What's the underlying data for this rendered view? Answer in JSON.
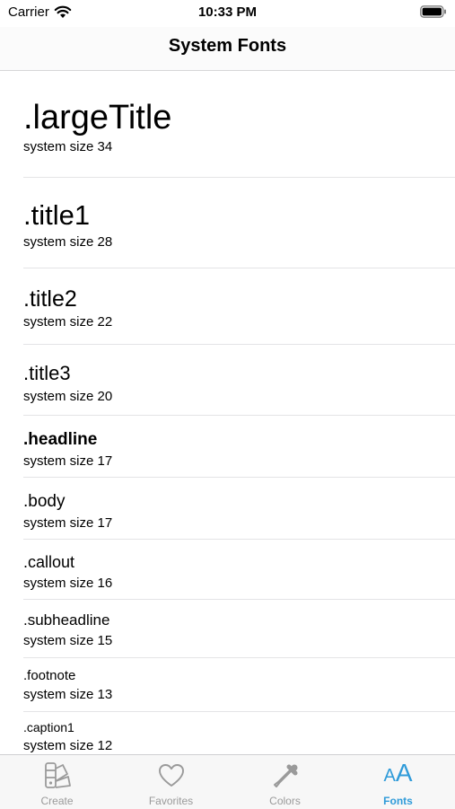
{
  "status_bar": {
    "carrier": "Carrier",
    "time": "10:33 PM"
  },
  "nav": {
    "title": "System Fonts"
  },
  "fonts": [
    {
      "name": ".largeTitle",
      "desc": "system size 34"
    },
    {
      "name": ".title1",
      "desc": "system size 28"
    },
    {
      "name": ".title2",
      "desc": "system size 22"
    },
    {
      "name": ".title3",
      "desc": "system size 20"
    },
    {
      "name": ".headline",
      "desc": "system size 17"
    },
    {
      "name": ".body",
      "desc": "system size 17"
    },
    {
      "name": ".callout",
      "desc": "system size 16"
    },
    {
      "name": ".subheadline",
      "desc": "system size 15"
    },
    {
      "name": ".footnote",
      "desc": "system size 13"
    },
    {
      "name": ".caption1",
      "desc": "system size 12"
    }
  ],
  "tabs": [
    {
      "label": "Create",
      "icon": "swatchbook-icon"
    },
    {
      "label": "Favorites",
      "icon": "heart-icon"
    },
    {
      "label": "Colors",
      "icon": "eyedropper-icon"
    },
    {
      "label": "Fonts",
      "icon": "text-size-icon",
      "glyph_small": "A",
      "glyph_big": "A"
    }
  ],
  "colors": {
    "accent": "#2f9bd9",
    "tab_inactive": "#9a9a9a"
  }
}
